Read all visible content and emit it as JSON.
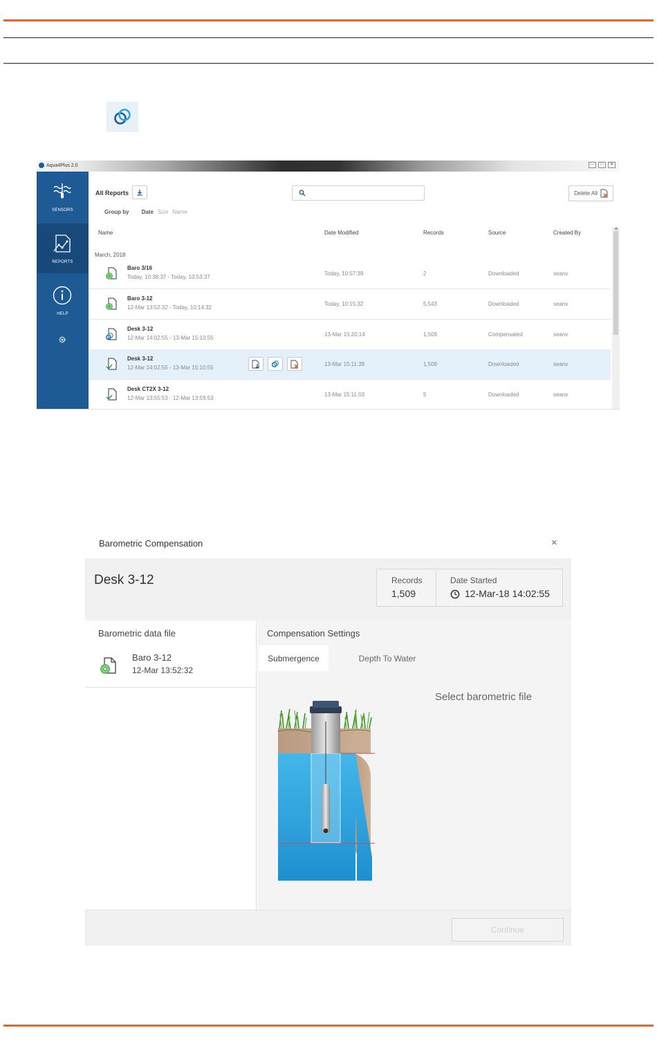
{
  "app": {
    "title": "Aqua4Plus 2.0",
    "window_buttons": [
      "—",
      "□",
      "✕"
    ]
  },
  "sidebar": {
    "items": [
      {
        "label": "SENSORS",
        "icon": "sensor-wave-icon"
      },
      {
        "label": "REPORTS",
        "icon": "report-chart-icon"
      },
      {
        "label": "HELP",
        "icon": "info-icon"
      },
      {
        "label": "",
        "icon": "gear-icon"
      }
    ]
  },
  "toolbar": {
    "all_reports": "All Reports",
    "group_by_label": "Group by",
    "group_options": [
      "Date",
      "Size",
      "Name"
    ],
    "search_placeholder": "",
    "delete_all": "Delete All"
  },
  "table": {
    "columns": [
      "Name",
      "Date Modified",
      "Records",
      "Source",
      "Created By"
    ],
    "group_header": "March, 2018",
    "rows": [
      {
        "name": "Baro 3/16",
        "range": "Today, 10:38:37 - Today, 10:53:37",
        "date": "Today, 10:57:39",
        "records": "2",
        "source": "Downloaded",
        "created_by": "seanv",
        "icon": "baro-file-icon"
      },
      {
        "name": "Baro 3-12",
        "range": "12-Mar 13:52:32 - Today, 10:14:32",
        "date": "Today, 10:15:32",
        "records": "5,543",
        "source": "Downloaded",
        "created_by": "seanv",
        "icon": "baro-file-icon"
      },
      {
        "name": "Desk 3-12",
        "range": "12-Mar 14:02:55 - 13-Mar 15:10:55",
        "date": "13-Mar 15:20:14",
        "records": "1,509",
        "source": "Compensated",
        "created_by": "seanv",
        "icon": "compensated-file-icon"
      },
      {
        "name": "Desk 3-12",
        "range": "12-Mar 14:02:55 - 13-Mar 15:10:55",
        "date": "13-Mar 15:11:39",
        "records": "1,509",
        "source": "Downloaded",
        "created_by": "seanv",
        "icon": "check-file-icon"
      },
      {
        "name": "Desk CT2X 3-12",
        "range": "12-Mar 13:55:53 - 12-Mar 13:59:53",
        "date": "13-Mar 15:11:03",
        "records": "5",
        "source": "Downloaded",
        "created_by": "seanv",
        "icon": "check-file-icon"
      }
    ]
  },
  "dialog": {
    "title": "Barometric Compensation",
    "close": "×",
    "file_title": "Desk 3-12",
    "records_label": "Records",
    "records_value": "1,509",
    "date_started_label": "Date Started",
    "date_started_value": "12-Mar-18 14:02:55",
    "baro_section_label": "Barometric data file",
    "baro_file_name": "Baro 3-12",
    "baro_file_date": "12-Mar 13:52:32",
    "comp_settings_label": "Compensation Settings",
    "tabs": [
      "Submergence",
      "Depth To Water"
    ],
    "select_prompt": "Select barometric file",
    "continue_label": "Continue"
  },
  "colors": {
    "accent_orange": "#e0692a",
    "sidebar_blue": "#1e5a93",
    "selected_row": "#e4f1fb",
    "water_blue": "#2aa3e0",
    "measure_red": "#d94a4a"
  }
}
